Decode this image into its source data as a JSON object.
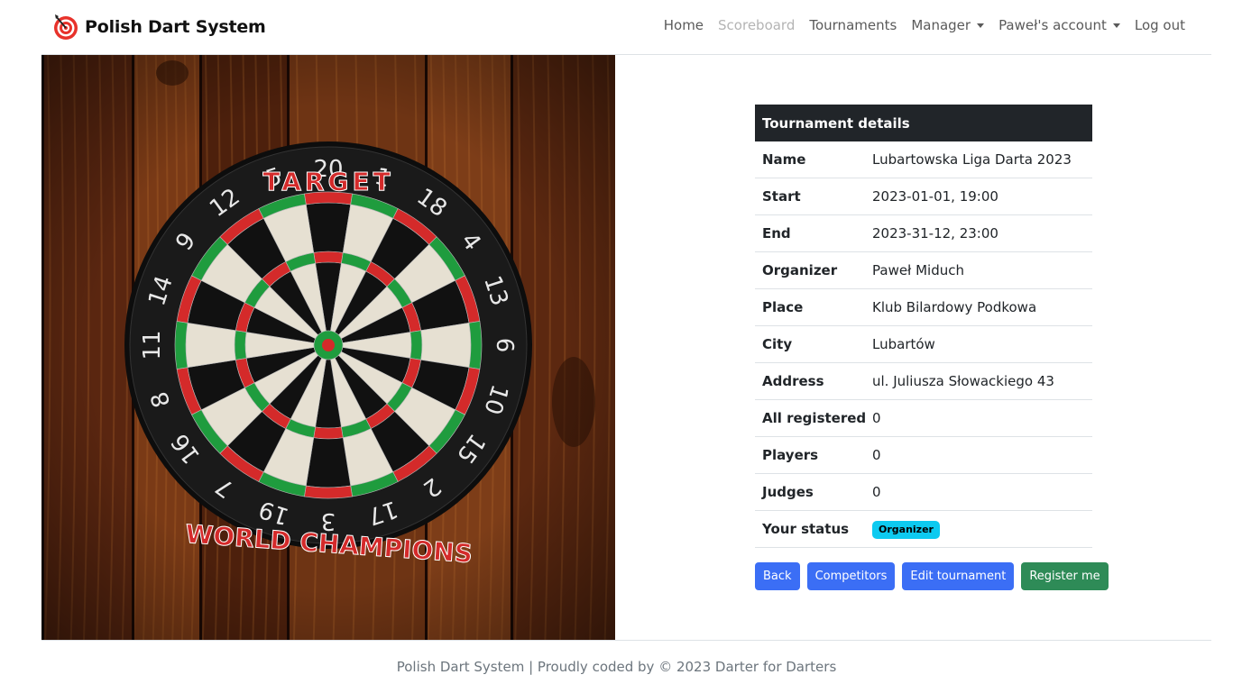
{
  "navbar": {
    "brand": "Polish Dart System",
    "brand_icon": "dartboard-target-icon",
    "links": {
      "home": "Home",
      "scoreboard": "Scoreboard",
      "tournaments": "Tournaments",
      "manager": "Manager",
      "account": "Paweł's account",
      "logout": "Log out"
    }
  },
  "photo": {
    "board_brand": "TARGET",
    "board_text": "WORLD CHAMPIONS",
    "board_numbers": [
      "20",
      "1",
      "18",
      "4",
      "13",
      "6",
      "10",
      "15",
      "2",
      "17",
      "3",
      "19",
      "7",
      "16",
      "8",
      "11",
      "14",
      "9",
      "12",
      "5"
    ]
  },
  "details": {
    "header": "Tournament details",
    "rows": [
      {
        "label": "Name",
        "value": "Lubartowska Liga Darta 2023"
      },
      {
        "label": "Start",
        "value": "2023-01-01, 19:00"
      },
      {
        "label": "End",
        "value": "2023-31-12, 23:00"
      },
      {
        "label": "Organizer",
        "value": "Paweł Miduch"
      },
      {
        "label": "Place",
        "value": "Klub Bilardowy Podkowa"
      },
      {
        "label": "City",
        "value": "Lubartów"
      },
      {
        "label": "Address",
        "value": "ul. Juliusza Słowackiego 43"
      },
      {
        "label": "All registered",
        "value": "0"
      },
      {
        "label": "Players",
        "value": "0"
      },
      {
        "label": "Judges",
        "value": "0"
      },
      {
        "label": "Your status",
        "value": "Organizer"
      }
    ]
  },
  "buttons": {
    "back": "Back",
    "competitors": "Competitors",
    "edit": "Edit tournament",
    "register": "Register me"
  },
  "colors": {
    "primary": "#3b6ef5",
    "success": "#2e8b57",
    "header_dark": "#212529",
    "badge_info": "#0dcaf0",
    "brand_red": "#e8322b"
  },
  "footer": {
    "text": "Polish Dart System | Proudly coded by © 2023 Darter for Darters"
  }
}
